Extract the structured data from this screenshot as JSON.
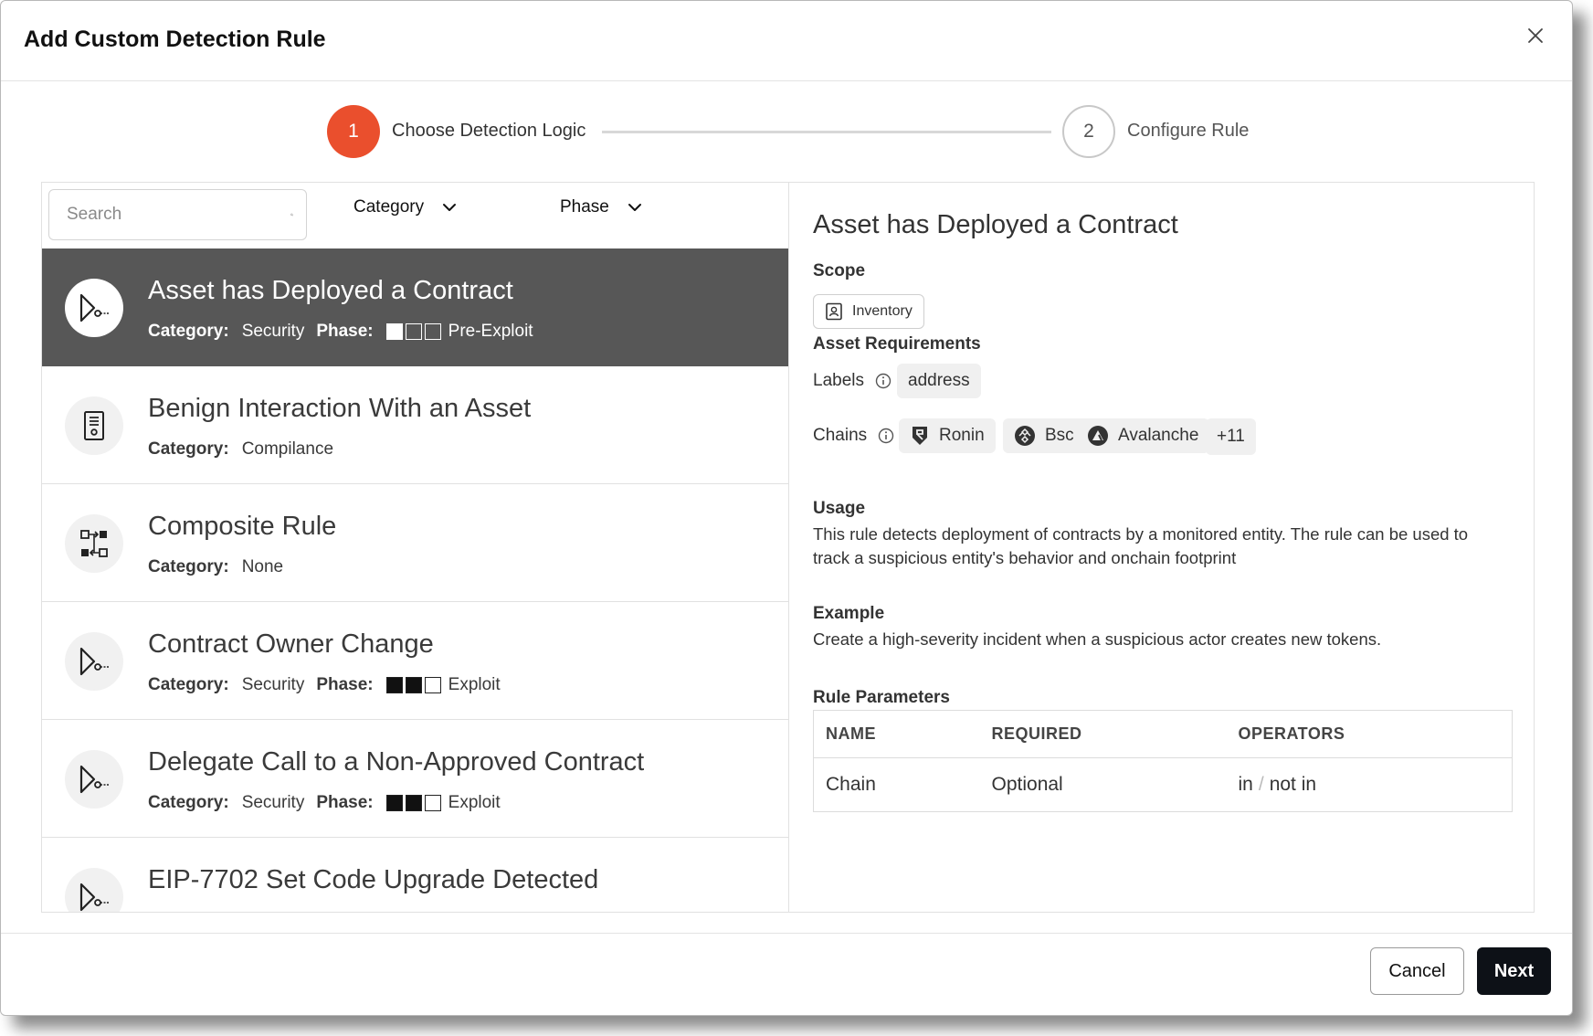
{
  "modal": {
    "title": "Add Custom Detection Rule"
  },
  "stepper": {
    "steps": [
      {
        "number": "1",
        "label": "Choose Detection Logic"
      },
      {
        "number": "2",
        "label": "Configure Rule"
      }
    ]
  },
  "filters": {
    "search_placeholder": "Search",
    "category_label": "Category",
    "phase_label": "Phase"
  },
  "rules": [
    {
      "title": "Asset has Deployed a Contract",
      "category_key": "Category:",
      "category": "Security",
      "phase_key": "Phase:",
      "phase": "Pre-Exploit",
      "phase_level": 0,
      "icon": "deploy-icon"
    },
    {
      "title": "Benign Interaction With an Asset",
      "category_key": "Category:",
      "category": "Compilance",
      "icon": "document-icon"
    },
    {
      "title": "Composite Rule",
      "category_key": "Category:",
      "category": "None",
      "icon": "composite-icon"
    },
    {
      "title": "Contract Owner Change",
      "category_key": "Category:",
      "category": "Security",
      "phase_key": "Phase:",
      "phase": "Exploit",
      "phase_level": 2,
      "icon": "deploy-icon"
    },
    {
      "title": "Delegate Call to a Non-Approved Contract",
      "category_key": "Category:",
      "category": "Security",
      "phase_key": "Phase:",
      "phase": "Exploit",
      "phase_level": 2,
      "icon": "deploy-icon"
    },
    {
      "title": "EIP-7702 Set Code Upgrade Detected",
      "icon": "deploy-icon"
    }
  ],
  "detail": {
    "title": "Asset has Deployed a Contract",
    "scope_heading": "Scope",
    "scope_chip": "Inventory",
    "asset_req_heading": "Asset Requirements",
    "labels_label": "Labels",
    "label_chip": "address",
    "chains_label": "Chains",
    "chains": [
      "Ronin",
      "Bsc",
      "Avalanche"
    ],
    "chains_more": "+11",
    "usage_heading": "Usage",
    "usage_text": "This rule detects deployment of contracts by a monitored entity. The rule can be used to track a suspicious entity's behavior and onchain footprint",
    "example_heading": "Example",
    "example_text": "Create a high-severity incident when a suspicious actor creates new tokens.",
    "params_heading": "Rule Parameters",
    "params_columns": [
      "NAME",
      "REQUIRED",
      "OPERATORS"
    ],
    "params_rows": [
      {
        "name": "Chain",
        "required": "Optional",
        "op1": "in",
        "op_sep": "/",
        "op2": "not in"
      }
    ]
  },
  "footer": {
    "cancel_label": "Cancel",
    "next_label": "Next"
  },
  "colors": {
    "accent": "#ea4f2d",
    "selected_row": "#575757",
    "primary_button": "#0d1117"
  }
}
